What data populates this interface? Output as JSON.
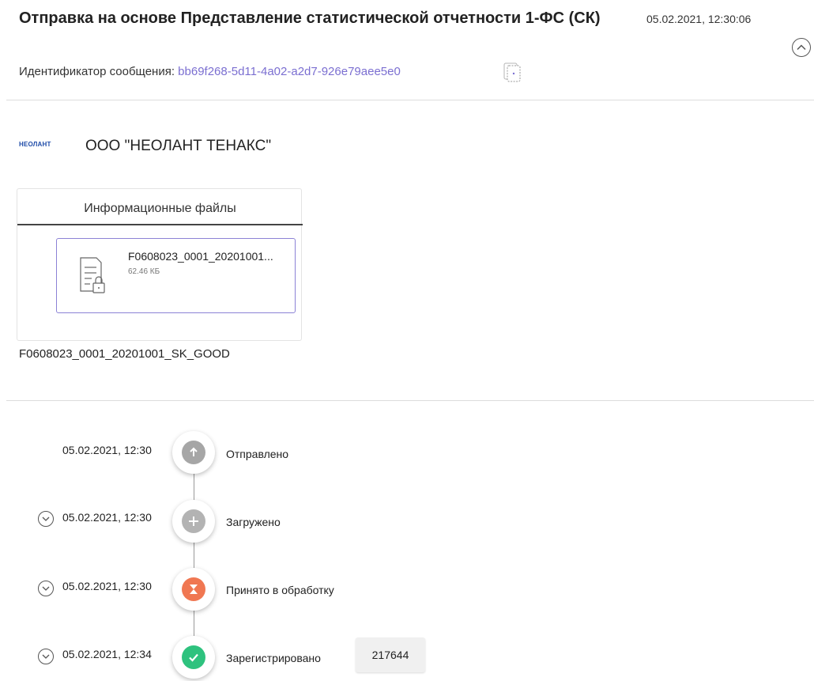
{
  "header": {
    "title": "Отправка на основе Представление статистической отчетности 1-ФС (СК)",
    "datetime": "05.02.2021, 12:30:06",
    "message_id_label": "Идентификатор сообщения: ",
    "message_id_value": "bb69f268-5d11-4a02-a2d7-926e79aee5e0"
  },
  "organization": {
    "logo_text": "НЕОЛАНТ",
    "name": "ООО \"НЕОЛАНТ ТЕНАКС\""
  },
  "files": {
    "tab_label": "Информационные файлы",
    "items": [
      {
        "name": "F0608023_0001_20201001...",
        "size": "62.46 КБ"
      }
    ],
    "caption": "F0608023_0001_20201001_SK_GOOD"
  },
  "timeline": [
    {
      "date": "05.02.2021, 12:30",
      "status": "Отправлено",
      "icon": "arrow-up-icon",
      "color": "#a6a6a6",
      "expandable": false
    },
    {
      "date": "05.02.2021, 12:30",
      "status": "Загружено",
      "icon": "plus-icon",
      "color": "#b3b3b3",
      "expandable": true
    },
    {
      "date": "05.02.2021, 12:30",
      "status": "Принято в обработку",
      "icon": "hourglass-icon",
      "color": "#f07752",
      "expandable": true
    },
    {
      "date": "05.02.2021, 12:34",
      "status": "Зарегистрировано",
      "icon": "check-icon",
      "color": "#2ec27e",
      "expandable": true,
      "number": "217644"
    }
  ]
}
